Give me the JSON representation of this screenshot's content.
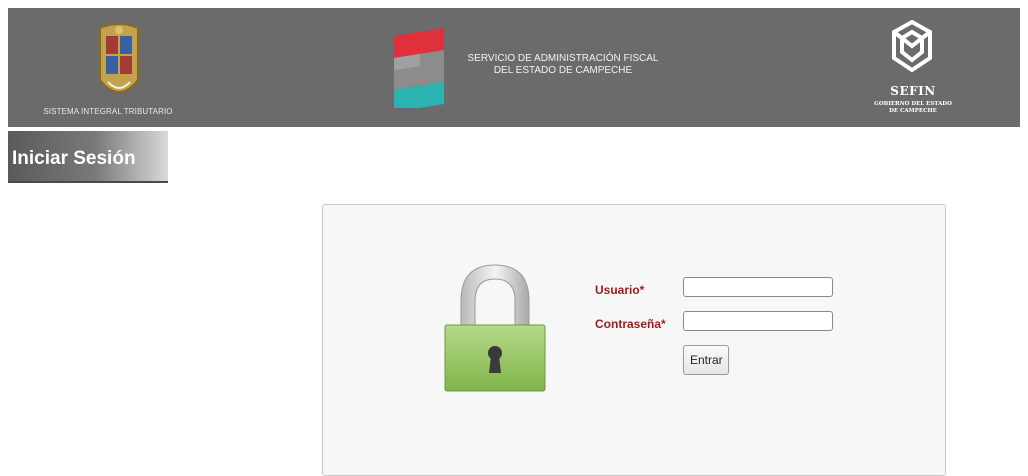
{
  "header": {
    "left_logo_caption": "SISTEMA INTEGRAL TRIBUTARIO",
    "center_title_line1": "SERVICIO DE ADMINISTRACIÓN FISCAL",
    "center_title_line2": "DEL ESTADO DE CAMPECHE",
    "right_logo_title": "SEFIN",
    "right_logo_sub_line1": "GOBIERNO DEL ESTADO",
    "right_logo_sub_line2": "DE CAMPECHE"
  },
  "section": {
    "title": "Iniciar Sesión"
  },
  "login": {
    "username_label": "Usuario*",
    "username_value": "",
    "password_label": "Contraseña*",
    "password_value": "",
    "submit_label": "Entrar"
  },
  "icons": {
    "left_logo": "coat-of-arms-icon",
    "center_logo": "saf-s-logo-icon",
    "right_logo": "sefin-logo-icon",
    "padlock": "padlock-icon"
  },
  "colors": {
    "header_bg": "#6b6b6b",
    "label_red": "#9b1c1c",
    "lock_green": "#8cc04f"
  }
}
